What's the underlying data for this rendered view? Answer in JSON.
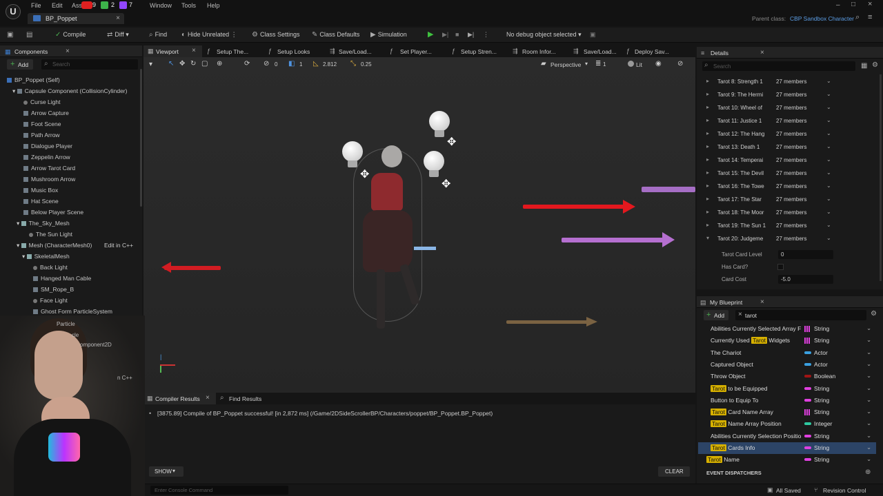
{
  "titlebar": {
    "menus": [
      "File",
      "Edit",
      "Asse",
      "Window",
      "Tools",
      "Help"
    ],
    "badges": [
      "9",
      "2",
      "7"
    ],
    "tab_title": "BP_Poppet",
    "parent_class_label": "Parent class:",
    "parent_class_value": "CBP Sandbox Character"
  },
  "toolbar": {
    "compile": "Compile",
    "diff": "Diff",
    "find": "Find",
    "hide_unrelated": "Hide Unrelated",
    "class_settings": "Class Settings",
    "class_defaults": "Class Defaults",
    "simulation": "Simulation",
    "debug_object": "No debug object selected"
  },
  "components": {
    "title": "Components",
    "add": "Add",
    "search_placeholder": "Search",
    "root": "BP_Poppet (Self)",
    "items": [
      "Capsule Component (CollisionCylinder)",
      "Curse Light",
      "Arrow Capture",
      "Foot Scene",
      "Path Arrow",
      "Dialogue Player",
      "Zeppelin Arrow",
      "Arrow Tarot Card",
      "Mushroom Arrow",
      "Music Box",
      "Hat Scene",
      "Below Player Scene",
      "The_Sky_Mesh",
      "The Sun Light",
      "Mesh (CharacterMesh0)",
      "SkeletalMesh",
      "Back Light",
      "Hanged Man Cable",
      "SM_Rope_B",
      "Face Light",
      "Ghost Form ParticleSystem",
      "Particle",
      "cle",
      "omponent2D",
      "n C++"
    ],
    "edit_in_cpp": "Edit in C++"
  },
  "viewport_tabs": [
    "Viewport",
    "Setup The...",
    "Setup Looks",
    "Save/Load...",
    "Set Player...",
    "Setup Stren...",
    "Room Infor...",
    "Save/Load...",
    "Deploy Sav..."
  ],
  "viewport_toolbar": {
    "grid_snap": "0",
    "rot_snap": "1",
    "fov": "2.812",
    "scale": "0.25",
    "view_mode": "Perspective",
    "lit": "Lit",
    "layer": "1"
  },
  "details": {
    "title": "Details",
    "search_placeholder": "Search",
    "rows": [
      {
        "name": "Tarot 8: Strength 1",
        "value": "27 members"
      },
      {
        "name": "Tarot 9: The Hermi",
        "value": "27 members"
      },
      {
        "name": "Tarot 10: Wheel of",
        "value": "27 members"
      },
      {
        "name": "Tarot 11: Justice 1",
        "value": "27 members"
      },
      {
        "name": "Tarot 12: The Hang",
        "value": "27 members"
      },
      {
        "name": "Tarot 13: Death 1",
        "value": "27 members"
      },
      {
        "name": "Tarot 14: Temperai",
        "value": "27 members"
      },
      {
        "name": "Tarot 15: The Devil",
        "value": "27 members"
      },
      {
        "name": "Tarot 16: The Towe",
        "value": "27 members"
      },
      {
        "name": "Tarot 17: The Star",
        "value": "27 members"
      },
      {
        "name": "Tarot 18: The Moor",
        "value": "27 members"
      },
      {
        "name": "Tarot 19: The Sun 1",
        "value": "27 members"
      },
      {
        "name": "Tarot 20: Judgeme",
        "value": "27 members"
      }
    ],
    "sub_rows": [
      {
        "name": "Tarot Card Level",
        "value": "0"
      },
      {
        "name": "Has Card?",
        "value": ""
      },
      {
        "name": "Card Cost",
        "value": "-5.0"
      }
    ]
  },
  "my_blueprint": {
    "title": "My Blueprint",
    "add": "Add",
    "search_value": "tarot",
    "variables": [
      {
        "pre": "",
        "hl": "",
        "post": "Abilities Currently Selected Array F",
        "type": "String",
        "color": "#e040e0",
        "multi": true,
        "selected": false
      },
      {
        "pre": "Currently Used ",
        "hl": "Tarot",
        "post": " Widgets",
        "type": "String",
        "color": "#e040e0",
        "multi": true,
        "selected": false
      },
      {
        "pre": "",
        "hl": "",
        "post": "The Chariot",
        "type": "Actor",
        "color": "#3aa0e0",
        "multi": false,
        "selected": false
      },
      {
        "pre": "",
        "hl": "",
        "post": "Captured Object",
        "type": "Actor",
        "color": "#3aa0e0",
        "multi": false,
        "selected": false
      },
      {
        "pre": "",
        "hl": "",
        "post": "Throw Object",
        "type": "Boolean",
        "color": "#a01414",
        "multi": false,
        "selected": false
      },
      {
        "pre": "",
        "hl": "Tarot",
        "post": " to be Equipped",
        "type": "String",
        "color": "#e040e0",
        "multi": false,
        "selected": false
      },
      {
        "pre": "",
        "hl": "",
        "post": "Button to Equip To",
        "type": "String",
        "color": "#e040e0",
        "multi": false,
        "selected": false
      },
      {
        "pre": "",
        "hl": "Tarot",
        "post": " Card Name Array",
        "type": "String",
        "color": "#e040e0",
        "multi": true,
        "selected": false
      },
      {
        "pre": "",
        "hl": "Tarot",
        "post": " Name Array Position",
        "type": "Integer",
        "color": "#2ec9a0",
        "multi": false,
        "selected": false
      },
      {
        "pre": "",
        "hl": "",
        "post": "Abilities Currently Selection Positio",
        "type": "String",
        "color": "#e040e0",
        "multi": false,
        "selected": false
      },
      {
        "pre": "",
        "hl": "Tarot",
        "post": " Cards Info",
        "type": "String",
        "color": "#e040e0",
        "multi": false,
        "selected": true
      },
      {
        "pre": "",
        "hl": "Tarot",
        "post": " Name",
        "type": "String",
        "color": "#e040e0",
        "multi": false,
        "selected": false
      }
    ],
    "event_dispatchers": "EVENT DISPATCHERS"
  },
  "compiler": {
    "tab_compiler": "Compiler Results",
    "tab_find": "Find Results",
    "message": "[3875.89] Compile of BP_Poppet successful! [in 2,872 ms] (/Game/2DSideScrollerBP/Characters/poppet/BP_Poppet.BP_Poppet)",
    "show": "SHOW",
    "clear": "CLEAR"
  },
  "status": {
    "console_placeholder": "Enter Console Command",
    "all_saved": "All Saved",
    "revision_control": "Revision Control"
  }
}
